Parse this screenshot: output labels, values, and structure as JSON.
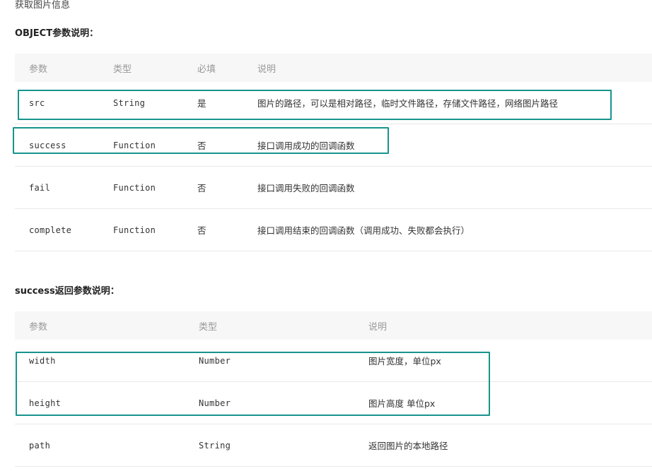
{
  "intro": "获取图片信息",
  "object_section": {
    "title": "OBJECT参数说明：",
    "headers": {
      "name": "参数",
      "type": "类型",
      "required": "必填",
      "desc": "说明"
    },
    "rows": [
      {
        "name": "src",
        "type": "String",
        "required": "是",
        "desc": "图片的路径，可以是相对路径，临时文件路径，存储文件路径，网络图片路径"
      },
      {
        "name": "success",
        "type": "Function",
        "required": "否",
        "desc": "接口调用成功的回调函数"
      },
      {
        "name": "fail",
        "type": "Function",
        "required": "否",
        "desc": "接口调用失败的回调函数"
      },
      {
        "name": "complete",
        "type": "Function",
        "required": "否",
        "desc": "接口调用结束的回调函数（调用成功、失败都会执行）"
      }
    ]
  },
  "success_section": {
    "title": "success返回参数说明：",
    "headers": {
      "name": "参数",
      "type": "类型",
      "desc": "说明"
    },
    "rows": [
      {
        "name": "width",
        "type": "Number",
        "desc": "图片宽度，单位px"
      },
      {
        "name": "height",
        "type": "Number",
        "desc": "图片高度 单位px"
      },
      {
        "name": "path",
        "type": "String",
        "desc": "返回图片的本地路径"
      }
    ]
  },
  "highlight_color": "#17948c"
}
